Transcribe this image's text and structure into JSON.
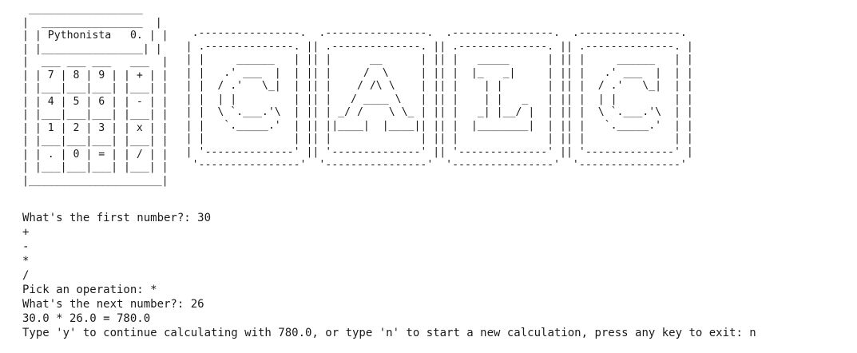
{
  "banner": {
    "calculator_art": " __________________\n|  ________________  |\n| | Pythonista   0. | |\n| |________________| |\n|  ___ ___ ___   ___  |\n| | 7 | 8 | 9 | | + | |\n| |___|___|___| |___| |\n| | 4 | 5 | 6 | | - | |\n| |___|___|___| |___| |\n| | 1 | 2 | 3 | | x | |\n| |___|___|___| |___| |\n| | . | 0 | = | | / | |\n| |___|___|___| |___| |\n|_____________________|",
    "title_art": " .----------------.  .----------------.  .----------------.  .----------------. \n| .--------------. || .--------------. || .--------------. || .--------------. |\n| |     ______   | || |      __      | || |   _____      | || |     ______   | |\n| |   .' ___  |  | || |     /  \\     | || |  |_   _|     | || |   .' ___  |  | |\n| |  / .'   \\_|  | || |    / /\\ \\    | || |    | |       | || |  / .'   \\_|  | |\n| |  | |         | || |   / ____ \\   | || |    | |   _   | || |  | |         | |\n| |  \\ `.___.'\\  | || | _/ /    \\ \\_ | || |   _| |__/ |  | || |  \\ `.___.'\\  | |\n| |   `._____.'  | || ||____|  |____|| || |  |________|  | || |   `._____.'  | |\n| |              | || |              | || |              | || |              | |\n| '--------------' || '--------------' || '--------------' || '--------------' |\n '----------------'  '----------------'  '----------------'  '----------------' "
  },
  "session": {
    "lines": [
      "What's the first number?: 30",
      "+",
      "-",
      "*",
      "/",
      "Pick an operation: *",
      "What's the next number?: 26",
      "30.0 * 26.0 = 780.0",
      "Type 'y' to continue calculating with 780.0, or type 'n' to start a new calculation, press any key to exit: n"
    ]
  }
}
